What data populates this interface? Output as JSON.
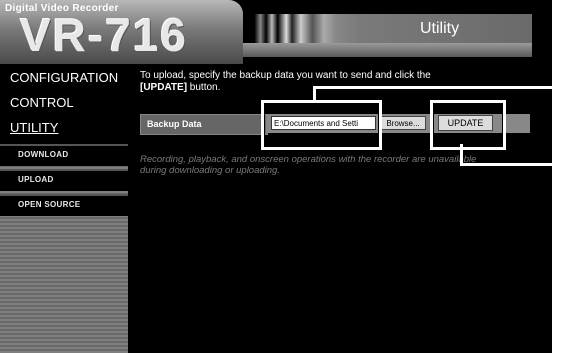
{
  "header": {
    "brand": "Digital Video Recorder",
    "model": "VR-716",
    "title": "Utility"
  },
  "sidebar": {
    "items": [
      {
        "label": "CONFIGURATION"
      },
      {
        "label": "CONTROL"
      },
      {
        "label": "UTILITY",
        "selected": true
      }
    ],
    "sub_items": [
      {
        "label": "DOWNLOAD"
      },
      {
        "label": "UPLOAD"
      },
      {
        "label": "OPEN SOURCE"
      }
    ]
  },
  "main": {
    "instruction_1": "To upload, specify the backup data you want to send and click the",
    "instruction_bold": "[UPDATE]",
    "instruction_2": " button.",
    "backup_label": "Backup Data",
    "file_value": "E:\\Documents and Setti",
    "browse_label": "Browse...",
    "update_label": "UPDATE",
    "warning": "Recording, playback, and onscreen operations with the recorder are unavailable during downloading or uploading."
  },
  "colors": {
    "background": "#000000",
    "sidebar_stripe": "#8a8a8a",
    "text": "#ffffff",
    "warning_text": "#7a7a7a"
  }
}
